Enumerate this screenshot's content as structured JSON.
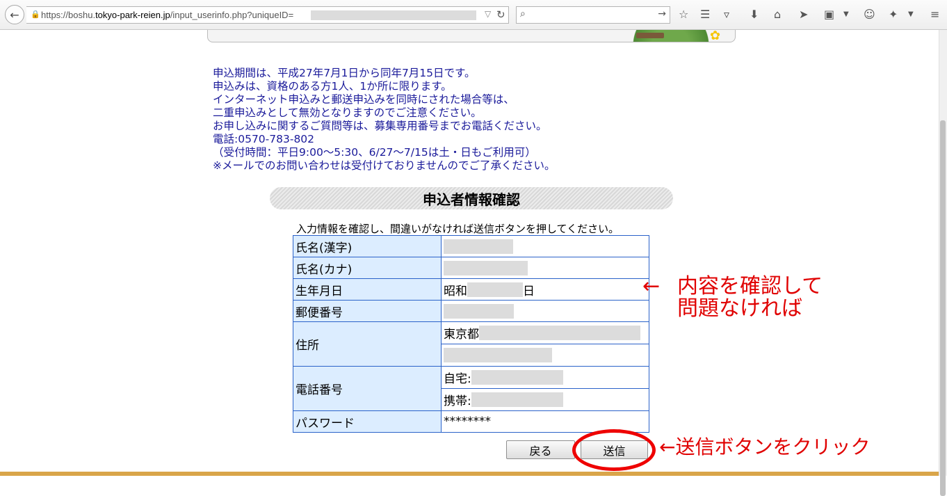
{
  "browser": {
    "url_prefix": "https://boshu.",
    "url_domain": "tokyo-park-reien.jp",
    "url_path": "/input_userinfo.php?uniqueID="
  },
  "notice_lines": [
    "申込期間は、平成27年7月1日から同年7月15日です。",
    "申込みは、資格のある方1人、1か所に限ります。",
    "インターネット申込みと郵送申込みを同時にされた場合等は、",
    "二重申込みとして無効となりますのでご注意ください。",
    "お申し込みに関するご質問等は、募集専用番号までお電話ください。",
    "電話:0570-783-802",
    "（受付時間：平日9:00～5:30、6/27～7/15は土・日もご利用可）",
    "※メールでのお問い合わせは受付けておりませんのでご了承ください。"
  ],
  "section_title": "申込者情報確認",
  "instruction": "入力情報を確認し、間違いがなければ送信ボタンを押してください。",
  "table": {
    "name_kanji_label": "氏名(漢字)",
    "name_kana_label": "氏名(カナ)",
    "birthdate_label": "生年月日",
    "birthdate_prefix": "昭和",
    "birthdate_suffix": "日",
    "postal_label": "郵便番号",
    "address_label": "住所",
    "address_prefix": "東京都",
    "phone_label": "電話番号",
    "phone_home_prefix": "自宅:",
    "phone_mobile_prefix": "携帯:",
    "password_label": "パスワード",
    "password_value": "********"
  },
  "buttons": {
    "back_label": "戻る",
    "submit_label": "送信"
  },
  "annotations": {
    "arrow": "←",
    "confirm_line1": "内容を確認して",
    "confirm_line2": "問題なければ",
    "click_hint": "←送信ボタンをクリック"
  },
  "colors": {
    "annotation_red": "#e00000",
    "table_border": "#2a62c9",
    "label_bg": "#dcedff",
    "notice_text": "#1a1a9a"
  }
}
